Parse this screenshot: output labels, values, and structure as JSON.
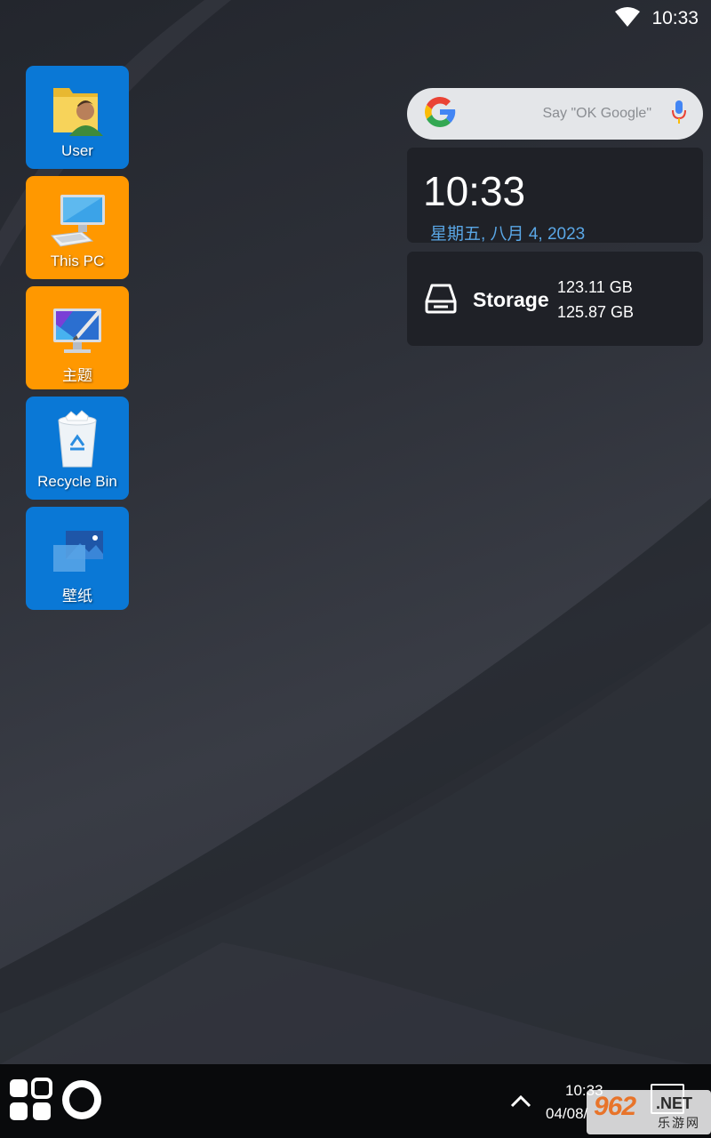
{
  "status_bar": {
    "time": "10:33",
    "wifi_icon": "wifi-icon"
  },
  "desktop_icons": [
    {
      "label": "User",
      "icon": "user-folder-icon",
      "color": "#0a78d6"
    },
    {
      "label": "This PC",
      "icon": "computer-icon",
      "color": "#ff9800"
    },
    {
      "label": "主题",
      "icon": "theme-icon",
      "color": "#ff9800"
    },
    {
      "label": "Recycle Bin",
      "icon": "recycle-bin-icon",
      "color": "#0a78d6"
    },
    {
      "label": "壁纸",
      "icon": "wallpaper-icon",
      "color": "#0a78d6"
    }
  ],
  "search": {
    "placeholder": "Say \"OK Google\"",
    "logo": "google-logo-icon",
    "mic": "mic-icon"
  },
  "clock_widget": {
    "time": "10:33",
    "date": "星期五, 八月 4, 2023"
  },
  "storage_widget": {
    "title": "Storage",
    "used": "123.11 GB",
    "total": "125.87 GB",
    "icon": "drive-icon"
  },
  "taskbar": {
    "time": "10:33",
    "date": "04/08/",
    "start_icon": "start-menu-icon",
    "circle_icon": "assistant-circle-icon",
    "tray_icon": "chevron-up-icon"
  },
  "watermark": {
    "brand": "962",
    "domain": ".NET",
    "cn": "乐游网"
  }
}
